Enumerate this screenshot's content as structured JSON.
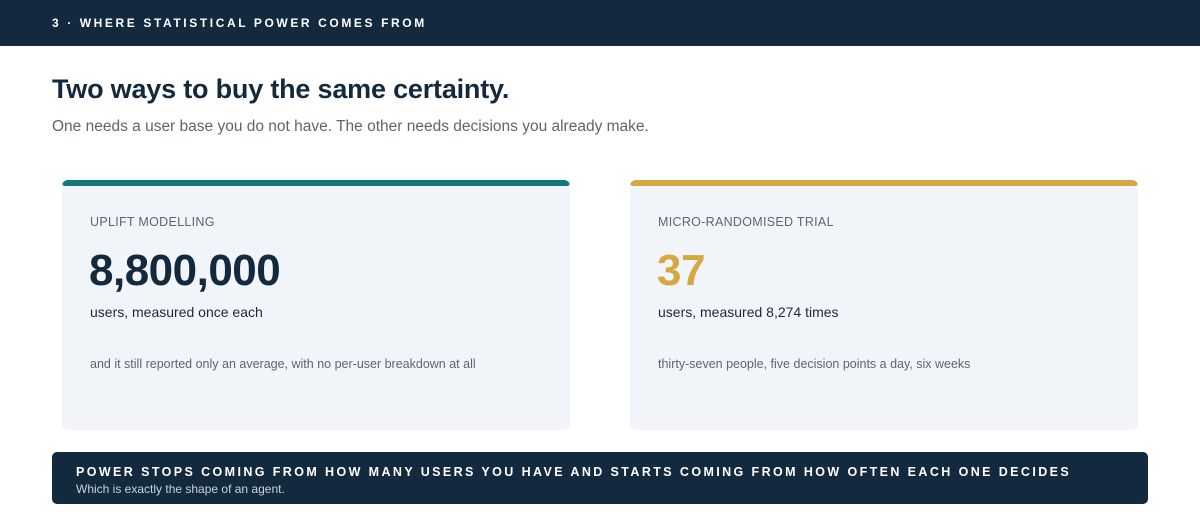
{
  "header": {
    "section_label": "3 · WHERE STATISTICAL POWER COMES FROM"
  },
  "title": "Two ways to buy the same certainty.",
  "subtitle": "One needs a user base you do not have. The other needs decisions you already make.",
  "cards": [
    {
      "label": "UPLIFT MODELLING",
      "value": "8,800,000",
      "unit": "users, measured once each",
      "note": "and it still reported only an average, with no per-user breakdown at all",
      "accent_color": "#13787b",
      "value_color": "#13293d"
    },
    {
      "label": "MICRO-RANDOMISED TRIAL",
      "value": "37",
      "unit": "users, measured 8,274 times",
      "note": "thirty-seven people, five decision points a day, six weeks",
      "accent_color": "#d6a842",
      "value_color": "#d6a842"
    }
  ],
  "banner": {
    "headline": "POWER STOPS COMING FROM HOW MANY USERS YOU HAVE AND STARTS COMING FROM HOW OFTEN EACH ONE DECIDES",
    "caption": "Which is exactly the shape of an agent."
  }
}
